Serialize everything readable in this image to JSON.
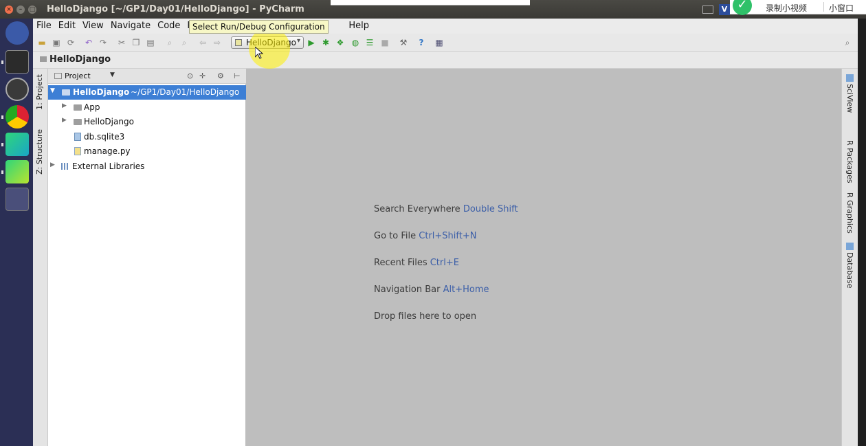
{
  "window": {
    "title": "HelloDjango [~/GP1/Day01/HelloDjango] - PyCharm"
  },
  "overlay": {
    "record_label": "录制小视频",
    "mini_window_label": "小窗口"
  },
  "menu": {
    "items": [
      "File",
      "Edit",
      "View",
      "Navigate",
      "Code",
      "Refa",
      "Help"
    ]
  },
  "toolbar": {
    "run_config_label": "HelloDjango",
    "tooltip": "Select Run/Debug Configuration"
  },
  "navbar": {
    "breadcrumb": "HelloDjango"
  },
  "left_tabs": {
    "project": "1: Project",
    "structure": "Z: Structure"
  },
  "project_panel": {
    "title": "Project",
    "tree": [
      {
        "label": "HelloDjango",
        "path": "~/GP1/Day01/HelloDjango",
        "type": "folder",
        "expanded": true,
        "selected": true
      },
      {
        "label": "App",
        "type": "folder"
      },
      {
        "label": "HelloDjango",
        "type": "folder"
      },
      {
        "label": "db.sqlite3",
        "type": "db-file"
      },
      {
        "label": "manage.py",
        "type": "py-file"
      },
      {
        "label": "External Libraries",
        "type": "library"
      }
    ]
  },
  "editor_hints": [
    {
      "text": "Search Everywhere",
      "key": "Double Shift"
    },
    {
      "text": "Go to File",
      "key": "Ctrl+Shift+N"
    },
    {
      "text": "Recent Files",
      "key": "Ctrl+E"
    },
    {
      "text": "Navigation Bar",
      "key": "Alt+Home"
    },
    {
      "text": "Drop files here to open",
      "key": ""
    }
  ],
  "right_tabs": [
    "SciView",
    "R Packages",
    "R Graphics",
    "Database"
  ],
  "colors": {
    "selection": "#3d7fd5",
    "editor_bg": "#bebebe",
    "shortcut_key": "#3c5fa8",
    "tooltip_bg": "#f7f7c6"
  }
}
